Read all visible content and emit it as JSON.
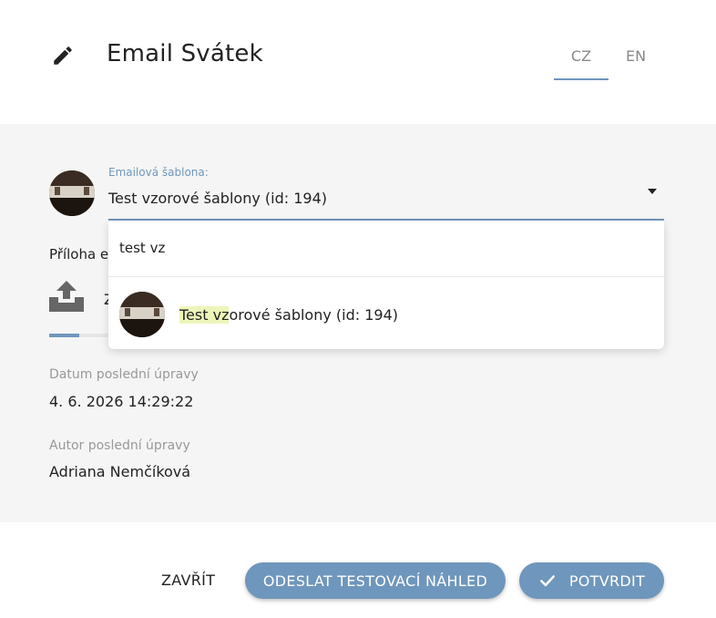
{
  "header": {
    "title": "Email Svátek",
    "languages": [
      {
        "label": "CZ",
        "active": true
      },
      {
        "label": "EN",
        "active": false
      }
    ]
  },
  "template_field": {
    "label": "Emailová šablona:",
    "value": "Test vzorové šablony (id: 194)"
  },
  "dropdown": {
    "search_value": "test vz",
    "option": {
      "highlight": "Test vz",
      "rest": "orové šablony (id: 194)"
    }
  },
  "attachment": {
    "label": "Příloha e",
    "upload_text": "Z",
    "progress": 0.275
  },
  "meta": {
    "modified_label": "Datum poslední úpravy",
    "modified_value": "4. 6. 2026 14:29:22",
    "author_label": "Autor poslední úpravy",
    "author_value": "Adriana Nemčíková"
  },
  "footer": {
    "close_label": "ZAVŘÍT",
    "send_preview_label": "ODESLAT TESTOVACÍ NÁHLED",
    "confirm_label": "POTVRDIT"
  },
  "colors": {
    "accent": "#6f96bc",
    "highlight": "#eef5b9",
    "body_bg": "#f5f5f5"
  }
}
